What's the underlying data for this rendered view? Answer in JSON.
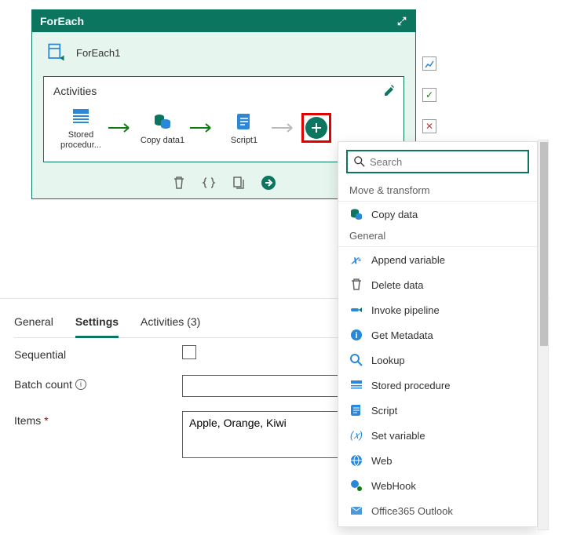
{
  "card": {
    "header_title": "ForEach",
    "name": "ForEach1"
  },
  "activities": {
    "title": "Activities",
    "items": [
      {
        "label": "Stored procedur...",
        "color": "#2b88d8"
      },
      {
        "label": "Copy data1",
        "color": "#0b7560"
      },
      {
        "label": "Script1",
        "color": "#2b88d8"
      }
    ]
  },
  "tabs": {
    "general": "General",
    "settings": "Settings",
    "activities": "Activities (3)"
  },
  "settings": {
    "sequential_label": "Sequential",
    "batch_label": "Batch count",
    "items_label": "Items",
    "items_value": "Apple, Orange, Kiwi"
  },
  "dropdown": {
    "search_placeholder": "Search",
    "sections": {
      "move": "Move & transform",
      "general": "General"
    },
    "move_items": [
      {
        "label": "Copy data"
      }
    ],
    "general_items": [
      {
        "label": "Append variable"
      },
      {
        "label": "Delete data"
      },
      {
        "label": "Invoke pipeline"
      },
      {
        "label": "Get Metadata"
      },
      {
        "label": "Lookup"
      },
      {
        "label": "Stored procedure"
      },
      {
        "label": "Script"
      },
      {
        "label": "Set variable"
      },
      {
        "label": "Web"
      },
      {
        "label": "WebHook"
      },
      {
        "label": "Office365 Outlook"
      }
    ]
  }
}
